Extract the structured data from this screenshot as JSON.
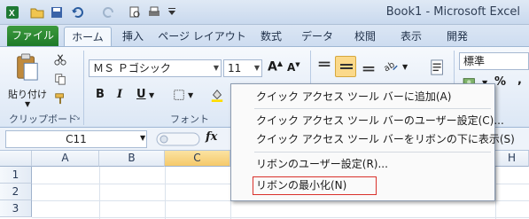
{
  "window": {
    "title": "Book1  -  Microsoft Excel"
  },
  "tabs": [
    {
      "label": "ファイル"
    },
    {
      "label": "ホーム"
    },
    {
      "label": "挿入"
    },
    {
      "label": "ページ レイアウト"
    },
    {
      "label": "数式"
    },
    {
      "label": "データ"
    },
    {
      "label": "校閲"
    },
    {
      "label": "表示"
    },
    {
      "label": "開発"
    }
  ],
  "ribbon": {
    "clipboard": {
      "paste_label": "貼り付け",
      "group_label": "クリップボード"
    },
    "font": {
      "font_name": "ＭＳ Ｐゴシック",
      "font_size": "11",
      "group_label": "フォント",
      "bold": "B",
      "italic": "I",
      "underline": "U"
    },
    "number": {
      "format": "標準",
      "percent": "%",
      "comma": ","
    }
  },
  "formula_bar": {
    "name_box": "C11",
    "fx": "fx"
  },
  "grid": {
    "columns": [
      "A",
      "B",
      "C",
      "H"
    ],
    "rows": [
      "1",
      "2",
      "3"
    ]
  },
  "context_menu": {
    "items": [
      "クイック アクセス ツール バーに追加(A)",
      "クイック アクセス ツール バーのユーザー設定(C)...",
      "クイック アクセス ツール バーをリボンの下に表示(S)",
      "リボンのユーザー設定(R)...",
      "リボンの最小化(N)"
    ]
  },
  "colors": {
    "file_tab": "#1e7a2a",
    "highlight_border": "#d9312b",
    "selected_column": "#f5c96a"
  }
}
